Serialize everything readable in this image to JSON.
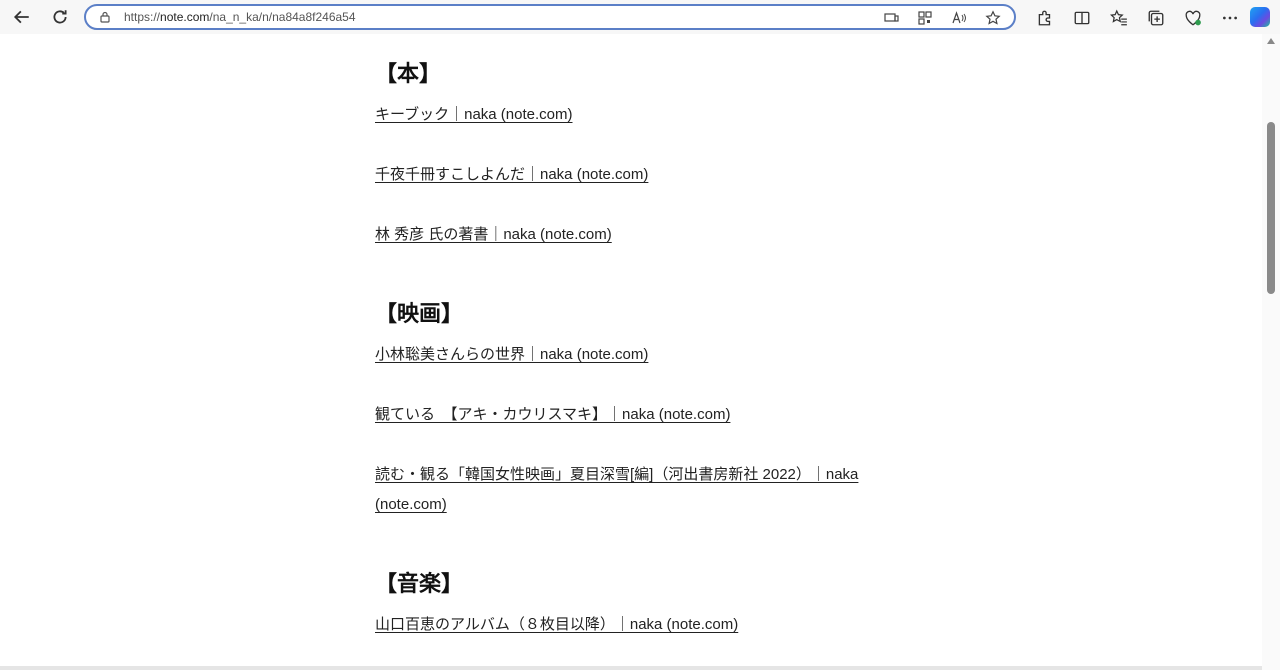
{
  "browser": {
    "url_scheme": "https://",
    "url_host": "note.com",
    "url_path": "/na_n_ka/n/na84a8f246a54"
  },
  "article": {
    "sections": [
      {
        "title": "【本】",
        "links": [
          "キーブック｜naka (note.com)",
          "千夜千冊すこしよんだ｜naka (note.com)",
          "林 秀彦 氏の著書｜naka (note.com)"
        ]
      },
      {
        "title": "【映画】",
        "links": [
          "小林聡美さんらの世界｜naka (note.com)",
          "観ている　【アキ・カウリスマキ】｜naka (note.com)",
          "読む・観る「韓国女性映画」夏目深雪[編]（河出書房新社 2022）｜naka (note.com)"
        ]
      },
      {
        "title": "【音楽】",
        "links": [
          "山口百恵のアルバム（８枚目以降）｜naka (note.com)"
        ]
      }
    ]
  }
}
